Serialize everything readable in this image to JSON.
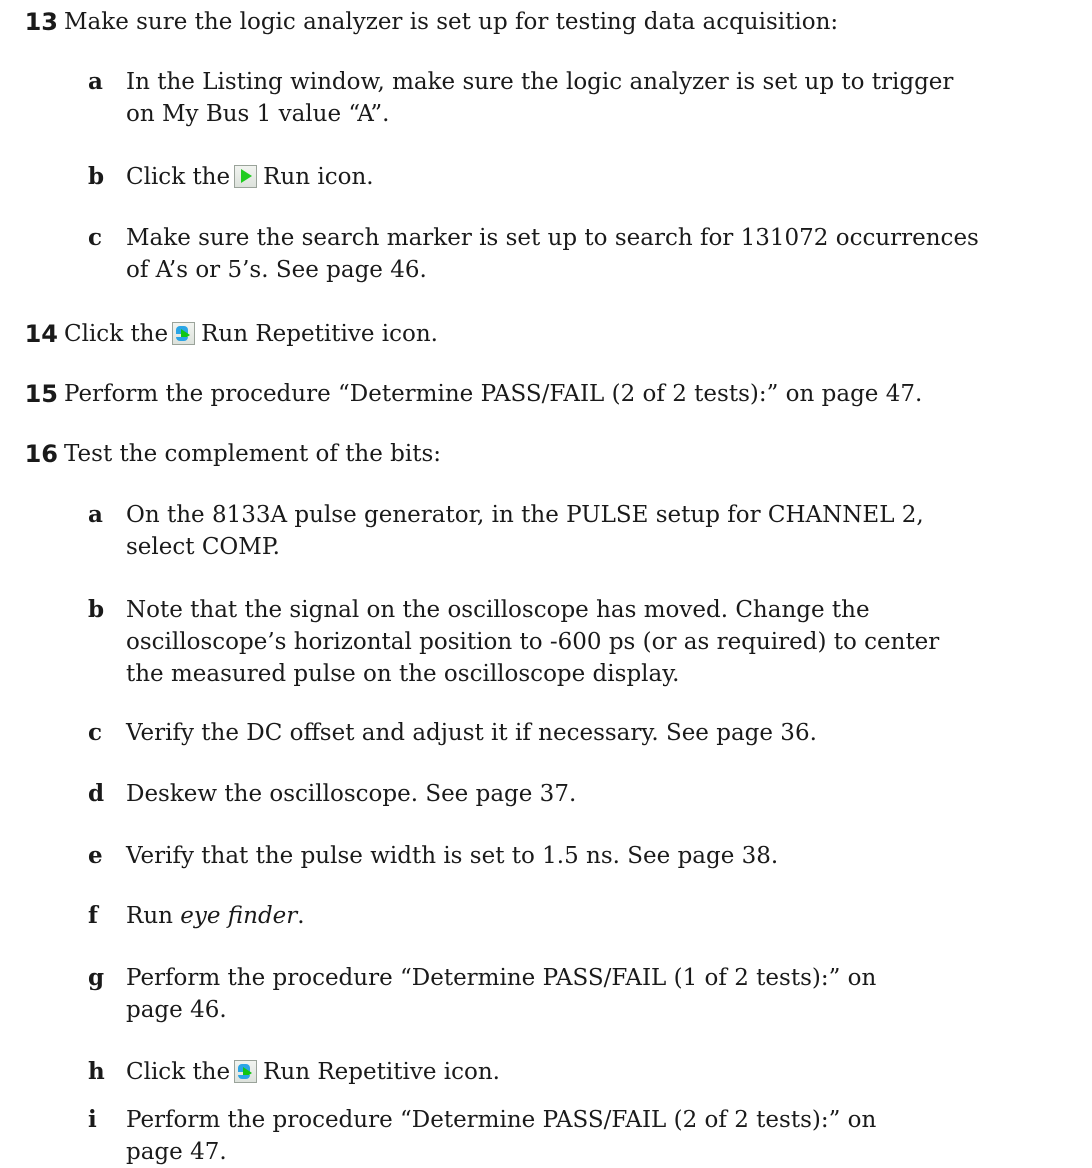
{
  "steps": [
    {
      "num": "13",
      "text": "Make sure the logic analyzer is set up for testing data acquisition:"
    },
    {
      "num": "14",
      "text_pre": "Click the",
      "text_post": "Run Repetitive icon."
    },
    {
      "num": "15",
      "text": "Perform the procedure “Determine PASS/FAIL (2 of 2 tests):” on page 47."
    },
    {
      "num": "16",
      "text": "Test the complement of the bits:"
    }
  ],
  "step13_subs": [
    {
      "letter": "a",
      "lines": [
        "In the Listing window, make sure the logic analyzer is set up to trigger",
        "on My Bus 1 value “A”."
      ]
    },
    {
      "letter": "b",
      "pre": "Click the",
      "post": "Run icon."
    },
    {
      "letter": "c",
      "lines": [
        "Make sure the search marker is set up to search for 131072 occurrences",
        "of A’s or 5’s. See page 46."
      ]
    }
  ],
  "step16_subs": [
    {
      "letter": "a",
      "lines": [
        "On the 8133A pulse generator, in the PULSE setup for CHANNEL 2,",
        "select COMP."
      ]
    },
    {
      "letter": "b",
      "lines": [
        "Note that the signal on the oscilloscope has moved. Change the",
        "oscilloscope’s horizontal position to -600 ps (or as required) to center",
        "the measured pulse on the oscilloscope display."
      ]
    },
    {
      "letter": "c",
      "lines": [
        "Verify the DC offset and adjust it if necessary. See page 36."
      ]
    },
    {
      "letter": "d",
      "lines": [
        "Deskew the oscilloscope. See page 37."
      ]
    },
    {
      "letter": "e",
      "lines": [
        "Verify that the pulse width is set to 1.5 ns. See page 38."
      ]
    },
    {
      "letter": "f",
      "pre": "Run",
      "italic": "eye finder",
      "post": "."
    },
    {
      "letter": "g",
      "lines": [
        "Perform the procedure “Determine PASS/FAIL (1 of 2 tests):” on",
        "page 46."
      ]
    },
    {
      "letter": "h",
      "pre": "Click the",
      "post": "Run Repetitive icon."
    },
    {
      "letter": "i",
      "lines": [
        "Perform the procedure “Determine PASS/FAIL (2 of 2 tests):” on",
        "page 47."
      ]
    }
  ],
  "icons": {
    "run": "run-icon",
    "run_repetitive": "run-repetitive-icon"
  }
}
